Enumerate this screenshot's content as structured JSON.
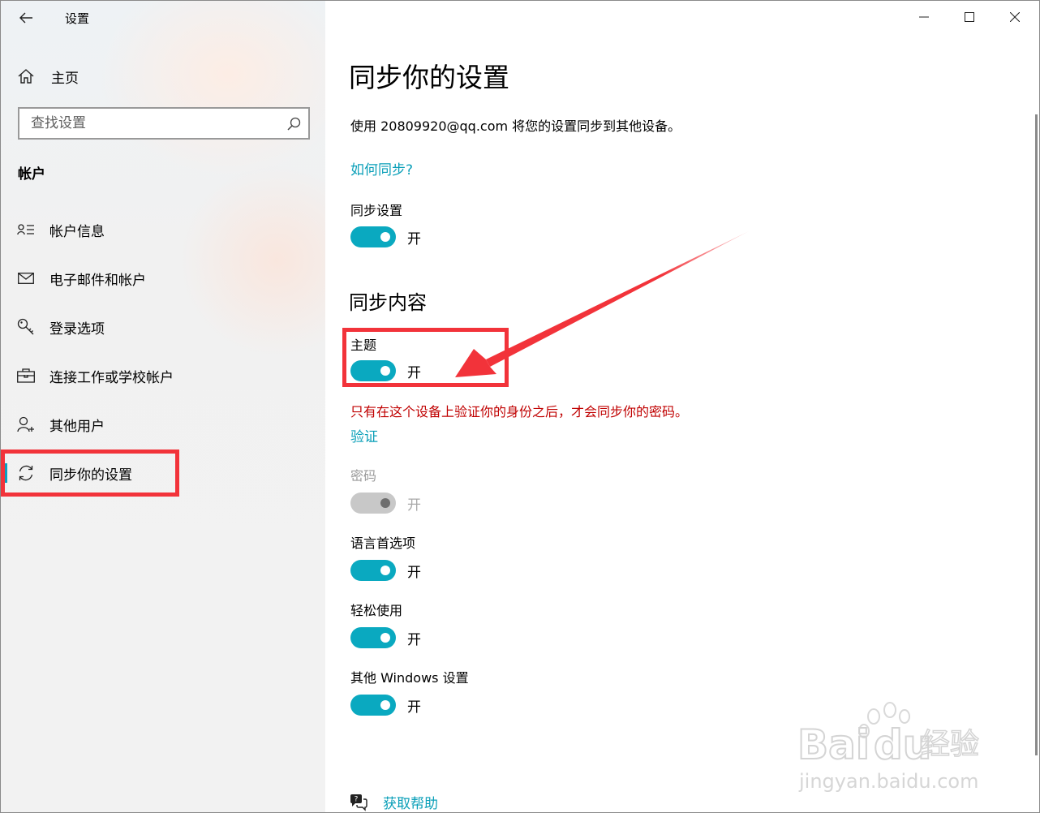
{
  "window": {
    "title": "设置",
    "controls": [
      "minimize",
      "maximize",
      "close"
    ]
  },
  "sidebar": {
    "home_label": "主页",
    "search_placeholder": "查找设置",
    "section_label": "帐户",
    "items": [
      {
        "label": "帐户信息",
        "icon": "account-info-icon"
      },
      {
        "label": "电子邮件和帐户",
        "icon": "mail-icon"
      },
      {
        "label": "登录选项",
        "icon": "key-icon"
      },
      {
        "label": "连接工作或学校帐户",
        "icon": "briefcase-icon"
      },
      {
        "label": "其他用户",
        "icon": "add-person-icon"
      },
      {
        "label": "同步你的设置",
        "icon": "sync-icon",
        "active": true
      }
    ]
  },
  "main": {
    "title": "同步你的设置",
    "description": "使用 20809920@qq.com 将您的设置同步到其他设备。",
    "how_link": "如何同步?",
    "sync_settings": {
      "label": "同步设置",
      "state": "开",
      "on": true
    },
    "sync_content_heading": "同步内容",
    "theme": {
      "label": "主题",
      "state": "开",
      "on": true
    },
    "warning": "只有在这个设备上验证你的身份之后，才会同步你的密码。",
    "verify_link": "验证",
    "password": {
      "label": "密码",
      "state": "开",
      "on": true,
      "disabled": true
    },
    "language": {
      "label": "语言首选项",
      "state": "开",
      "on": true
    },
    "ease_of_access": {
      "label": "轻松使用",
      "state": "开",
      "on": true
    },
    "other_windows": {
      "label": "其他 Windows 设置",
      "state": "开",
      "on": true
    },
    "help_link": "获取帮助"
  },
  "watermark": {
    "brand": "Baidu经验",
    "url": "jingyan.baidu.com"
  },
  "colors": {
    "accent": "#0aa9c0",
    "link": "#0a9fb8",
    "warning": "#c00000",
    "annotation": "#f2333a"
  }
}
